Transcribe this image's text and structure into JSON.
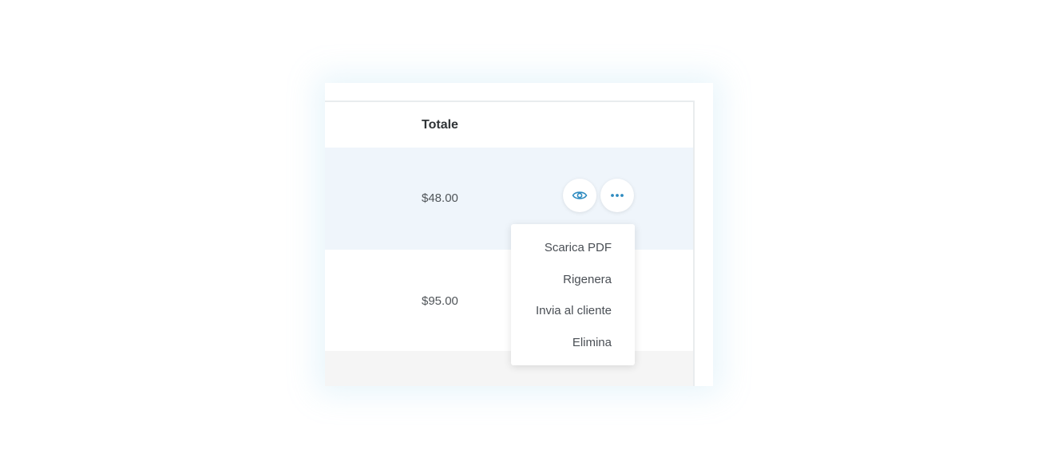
{
  "table": {
    "columns": {
      "total": "Totale"
    },
    "rows": [
      {
        "total": "$48.00",
        "highlighted": true
      },
      {
        "total": "$95.00",
        "highlighted": false
      }
    ]
  },
  "actions": {
    "view_icon": "eye-icon",
    "more_icon": "more-horizontal-icon"
  },
  "dropdown": {
    "items": [
      {
        "label": "Scarica PDF"
      },
      {
        "label": "Rigenera"
      },
      {
        "label": "Invia al cliente"
      },
      {
        "label": "Elimina"
      }
    ]
  },
  "colors": {
    "accent": "#2e8bc0",
    "highlight_row": "#eff5fb"
  }
}
